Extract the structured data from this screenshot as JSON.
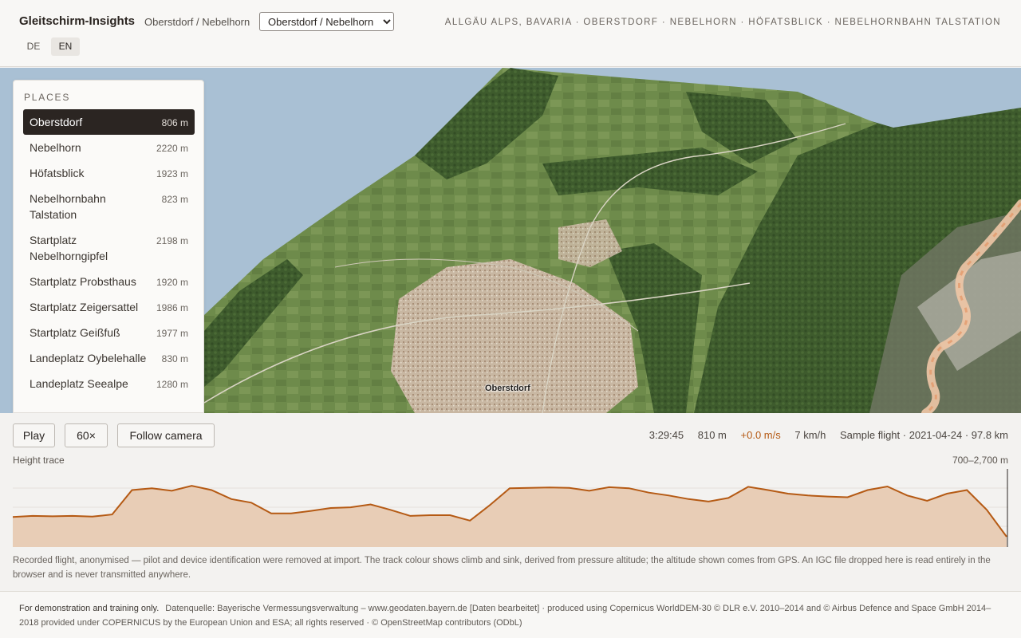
{
  "header": {
    "brand": "Gleitschirm-Insights",
    "subtitle": "Oberstdorf / Nebelhorn",
    "site_select": {
      "selected": "Oberstdorf / Nebelhorn"
    },
    "languages": [
      {
        "label": "DE",
        "active": false
      },
      {
        "label": "EN",
        "active": true
      }
    ],
    "breadcrumb": "ALLGÄU ALPS, BAVARIA · OBERSTDORF · NEBELHORN · HÖFATSBLICK · NEBELHORNBAHN TALSTATION"
  },
  "map": {
    "label": "Oberstdorf",
    "colors": {
      "sky": "#a9c0d4",
      "forest": "#3d5a2c",
      "meadow": "#6f8a4a",
      "town": "#c9b8a4",
      "track": "#e9b48c"
    }
  },
  "places": {
    "title": "PLACES",
    "items": [
      {
        "name": "Oberstdorf",
        "alt": "806 m",
        "active": true
      },
      {
        "name": "Nebelhorn",
        "alt": "2220 m"
      },
      {
        "name": "Höfatsblick",
        "alt": "1923 m"
      },
      {
        "name": "Nebelhornbahn Talstation",
        "alt": "823 m"
      },
      {
        "name": "Startplatz Nebelhorngipfel",
        "alt": "2198 m"
      },
      {
        "name": "Startplatz Probsthaus",
        "alt": "1920 m"
      },
      {
        "name": "Startplatz Zeigersattel",
        "alt": "1986 m"
      },
      {
        "name": "Startplatz Geißfuß",
        "alt": "1977 m"
      },
      {
        "name": "Landeplatz Oybelehalle",
        "alt": "830 m"
      },
      {
        "name": "Landeplatz Seealpe",
        "alt": "1280 m"
      }
    ]
  },
  "controls": {
    "play": "Play",
    "speed": "60×",
    "follow": "Follow camera",
    "time": "3:29:45",
    "altitude": "810 m",
    "vario": "+0.0 m/s",
    "speed_kmh": "7 km/h",
    "flight": "Sample flight · 2021-04-24 · 97.8 km",
    "trace_label": "Height trace",
    "trace_range": "700–2,700 m",
    "accent": "#b55a14"
  },
  "chart_data": {
    "type": "area",
    "ylim": [
      700,
      2700
    ],
    "x": [
      0,
      2,
      4,
      6,
      8,
      10,
      12,
      14,
      16,
      18,
      20,
      22,
      24,
      26,
      28,
      30,
      32,
      34,
      36,
      38,
      40,
      42,
      44,
      46,
      48,
      50,
      52,
      54,
      56,
      58,
      60,
      62,
      64,
      66,
      68,
      70,
      72,
      74,
      76,
      78,
      80,
      82,
      84,
      86,
      88,
      90,
      92,
      94,
      96,
      98,
      100
    ],
    "values": [
      1450,
      1480,
      1470,
      1480,
      1460,
      1520,
      2200,
      2250,
      2180,
      2320,
      2200,
      1950,
      1850,
      1550,
      1550,
      1620,
      1700,
      1720,
      1800,
      1650,
      1480,
      1500,
      1500,
      1350,
      1780,
      2250,
      2260,
      2270,
      2260,
      2180,
      2280,
      2250,
      2130,
      2050,
      1950,
      1880,
      1980,
      2290,
      2200,
      2100,
      2050,
      2020,
      2000,
      2200,
      2300,
      2050,
      1900,
      2100,
      2200,
      1650,
      900
    ]
  },
  "note": "Recorded flight, anonymised — pilot and device identification were removed at import. The track colour shows climb and sink, derived from pressure altitude; the altitude shown comes from GPS. An IGC file dropped here is read entirely in the browser and is never transmitted anywhere.",
  "footer": {
    "demo": "For demonstration and training only.",
    "attribution": "Datenquelle: Bayerische Vermessungsverwaltung – www.geodaten.bayern.de [Daten bearbeitet] · produced using Copernicus WorldDEM-30 © DLR e.V. 2010–2014 and © Airbus Defence and Space GmbH 2014–2018 provided under COPERNICUS by the European Union and ESA; all rights reserved · © OpenStreetMap contributors (ODbL)"
  }
}
